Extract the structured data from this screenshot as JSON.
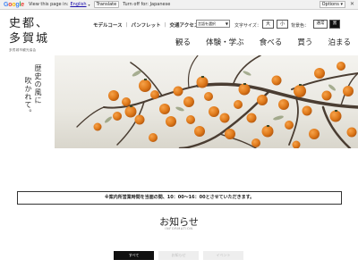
{
  "translate_bar": {
    "logo_parts": [
      "G",
      "o",
      "o",
      "g",
      "l",
      "e"
    ],
    "view_text": "View this page in:",
    "language": "English",
    "translate_button": "Translate",
    "turn_off": "Turn off for: Japanese",
    "options": "Options ▾",
    "close": "✕"
  },
  "site": {
    "logo_line1": "史都、",
    "logo_line2": "多賀城",
    "logo_sub": "多賀城市観光協会"
  },
  "top_nav": {
    "links": [
      "モデルコース",
      "パンフレット",
      "交通アクセス"
    ],
    "separator": "|",
    "translate_select": "言語を選択",
    "font_size_label": "文字サイズ：",
    "font_large": "大",
    "font_small": "小",
    "bg_label": "背景色：",
    "bg_normal": "通常",
    "bg_black": "黒"
  },
  "main_nav": [
    "観る",
    "体験・学ぶ",
    "食べる",
    "買う",
    "泊まる"
  ],
  "hero": {
    "tagline_col1": "歴史の風に",
    "tagline_col2": "吹かれて。"
  },
  "notice": "※案内所営業時間を当面の間、10：00～16：00とさせていただきます。",
  "news": {
    "title": "お知らせ",
    "subtitle": "INFORMATION",
    "tabs": [
      "すべて",
      "お知らせ",
      "イベント"
    ],
    "active_tab": 0
  },
  "colors": {
    "persimmon": "#e07b1c",
    "bg_black_button": "#111111",
    "active_tab": "#111111",
    "inactive_tab": "#eeeeee"
  }
}
